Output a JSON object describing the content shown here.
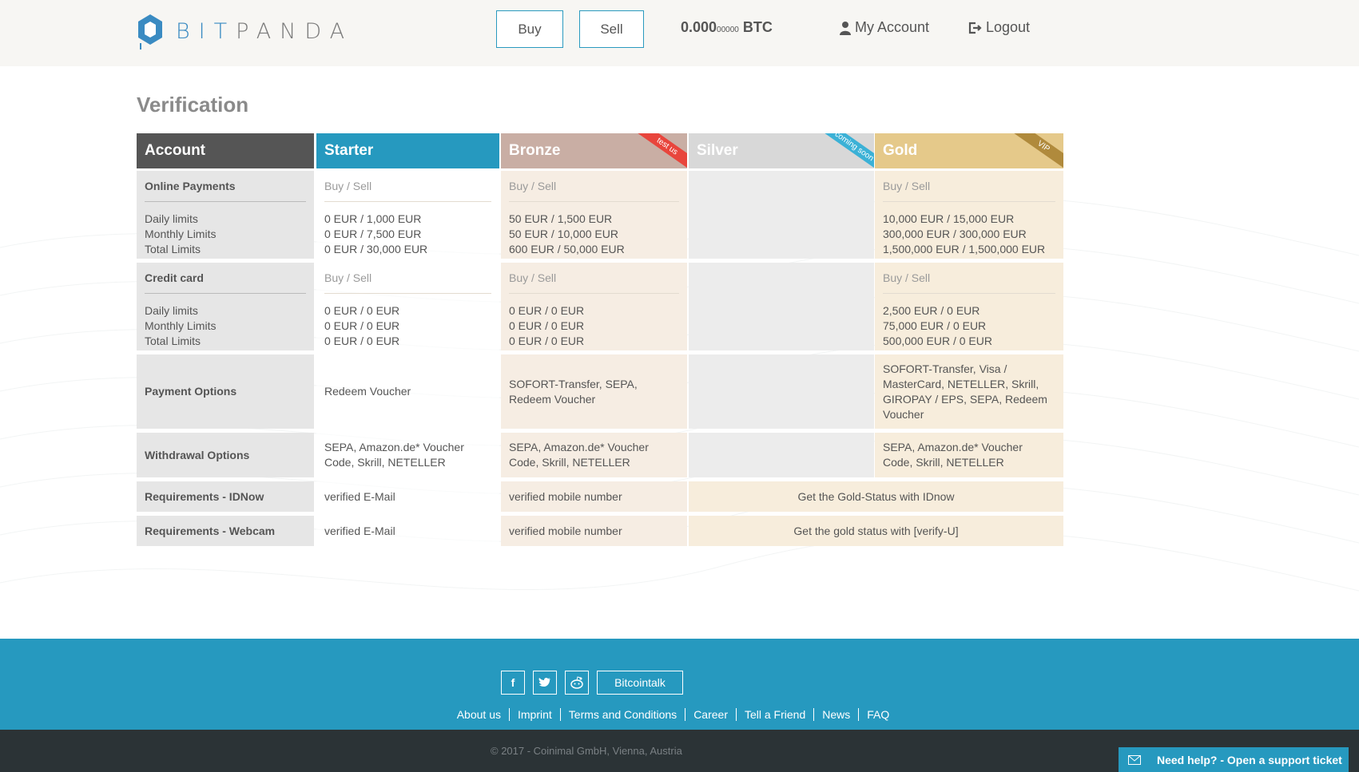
{
  "logo": {
    "part1": "BIT",
    "part2": "PANDA"
  },
  "header": {
    "buy": "Buy",
    "sell": "Sell",
    "balance_main": "0.000",
    "balance_small": "00000",
    "balance_unit": "BTC",
    "my_account": "My Account",
    "logout": "Logout"
  },
  "page_title": "Verification",
  "columns": {
    "account": "Account",
    "starter": "Starter",
    "bronze": "Bronze",
    "bronze_ribbon": "test us",
    "silver": "Silver",
    "silver_ribbon": "coming soon",
    "gold": "Gold",
    "gold_ribbon": "VIP"
  },
  "rows": {
    "online": {
      "label": "Online Payments",
      "daily": "Daily limits",
      "monthly": "Monthly Limits",
      "total": "Total Limits",
      "starter": {
        "type": "Buy / Sell",
        "daily": "0 EUR / 1,000 EUR",
        "monthly": "0 EUR / 7,500 EUR",
        "total": "0 EUR / 30,000 EUR"
      },
      "bronze": {
        "type": "Buy / Sell",
        "daily": "50 EUR / 1,500 EUR",
        "monthly": "50 EUR / 10,000 EUR",
        "total": "600 EUR / 50,000 EUR"
      },
      "gold": {
        "type": "Buy / Sell",
        "daily": "10,000 EUR / 15,000 EUR",
        "monthly": "300,000 EUR / 300,000 EUR",
        "total": "1,500,000 EUR / 1,500,000 EUR"
      }
    },
    "credit": {
      "label": "Credit card",
      "daily": "Daily limits",
      "monthly": "Monthly Limits",
      "total": "Total Limits",
      "starter": {
        "type": "Buy / Sell",
        "daily": "0 EUR / 0 EUR",
        "monthly": "0 EUR / 0 EUR",
        "total": "0 EUR / 0 EUR"
      },
      "bronze": {
        "type": "Buy / Sell",
        "daily": "0 EUR / 0 EUR",
        "monthly": "0 EUR / 0 EUR",
        "total": "0 EUR / 0 EUR"
      },
      "gold": {
        "type": "Buy / Sell",
        "daily": "2,500 EUR / 0 EUR",
        "monthly": "75,000 EUR / 0 EUR",
        "total": "500,000 EUR / 0 EUR"
      }
    },
    "payment": {
      "label": "Payment Options",
      "starter": "Redeem Voucher",
      "bronze": "SOFORT-Transfer, SEPA, Redeem Voucher",
      "gold": "SOFORT-Transfer, Visa / MasterCard, NETELLER, Skrill, GIROPAY / EPS, SEPA, Redeem Voucher"
    },
    "withdrawal": {
      "label": "Withdrawal Options",
      "starter": "SEPA, Amazon.de* Voucher Code, Skrill, NETELLER",
      "bronze": "SEPA, Amazon.de* Voucher Code, Skrill, NETELLER",
      "gold": "SEPA, Amazon.de* Voucher Code, Skrill, NETELLER"
    },
    "idnow": {
      "label": "Requirements - IDNow",
      "starter": "verified E-Mail",
      "bronze": "verified mobile number",
      "silver_gold": "Get the Gold-Status with IDnow"
    },
    "webcam": {
      "label": "Requirements - Webcam",
      "starter": "verified E-Mail",
      "bronze": "verified mobile number",
      "silver_gold": "Get the gold status with [verify-U]"
    }
  },
  "footer": {
    "facebook": "f",
    "bitcointalk": "Bitcointalk",
    "links": [
      "About us",
      "Imprint",
      "Terms and Conditions",
      "Career",
      "Tell a Friend",
      "News",
      "FAQ"
    ],
    "copyright": "© 2017 - Coinimal GmbH, Vienna, Austria",
    "support": "Need help? - Open a support ticket"
  },
  "colors": {
    "accent": "#2699bf",
    "bronze": "#c9aea4",
    "gold": "#e5c98a",
    "dark": "#2b3336"
  }
}
